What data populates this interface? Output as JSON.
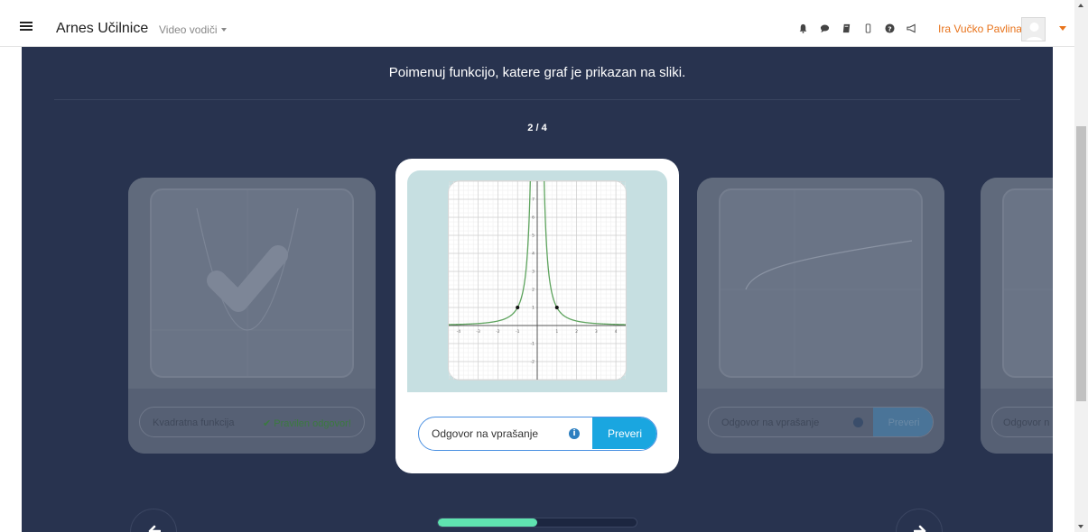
{
  "navbar": {
    "brand": "Arnes Učilnice",
    "menu_label": "Video vodiči",
    "user_name": "Ira Vučko Pavlina",
    "icons": [
      "bell-icon",
      "chat-icon",
      "book-icon",
      "mobile-icon",
      "help-icon",
      "megaphone-icon"
    ]
  },
  "quiz": {
    "question": "Poimenuj funkcijo, katere graf je prikazan na sliki.",
    "counter": "2 / 4",
    "progress_fraction": 0.5,
    "cards": [
      {
        "state": "answered",
        "answer": "Kvadratna funkcija",
        "feedback": "Pravilen odgovor!",
        "graph": "parabola"
      },
      {
        "state": "active",
        "placeholder": "Odgovor na vprašanje",
        "button": "Preveri",
        "graph": "reciprocal-square"
      },
      {
        "state": "upcoming",
        "placeholder": "Odgovor na vprašanje",
        "button": "Preveri",
        "graph": "square-root"
      },
      {
        "state": "upcoming",
        "placeholder": "Odgovor n",
        "graph": "unknown"
      }
    ]
  },
  "colors": {
    "panel": "#28334f",
    "accent_button": "#1aa6e0",
    "progress": "#5fe3b0",
    "user_link": "#e8731b",
    "correct": "#4caf50"
  }
}
